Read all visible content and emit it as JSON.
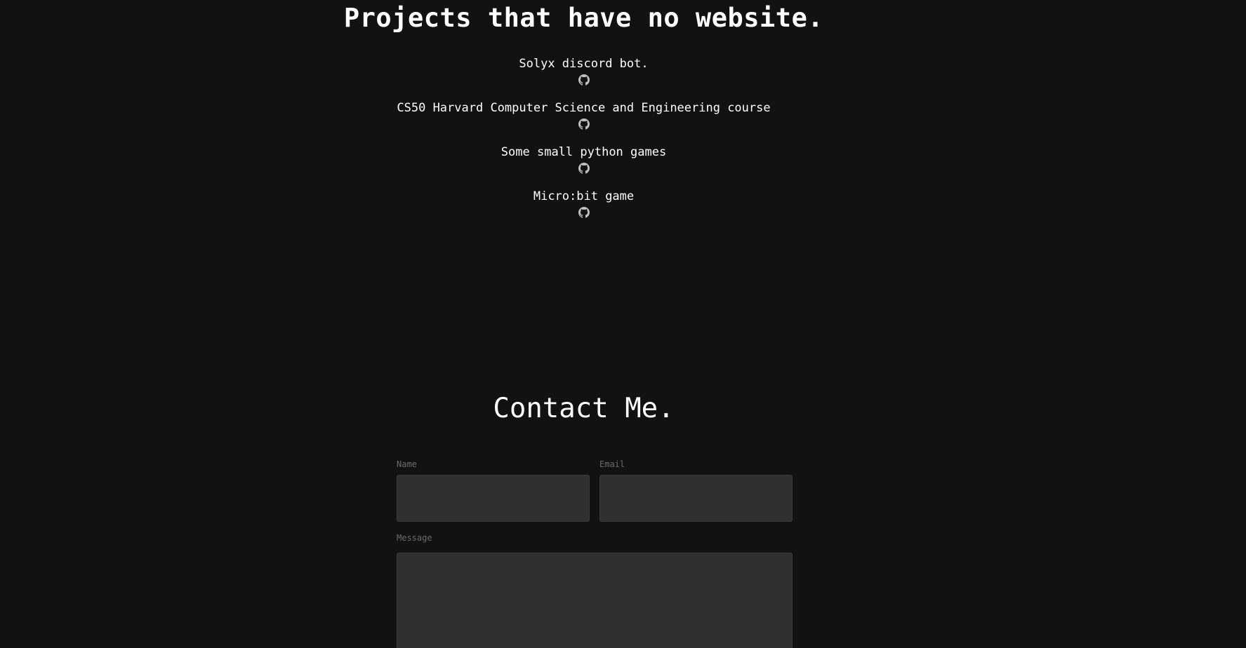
{
  "projects_section": {
    "title": "Projects that have no website.",
    "items": [
      {
        "name": "Solyx discord bot.",
        "icon": "github-icon"
      },
      {
        "name": "CS50 Harvard Computer Science and Engineering course",
        "icon": "github-icon"
      },
      {
        "name": "Some small python games",
        "icon": "github-icon"
      },
      {
        "name": "Micro:bit game",
        "icon": "github-icon"
      }
    ]
  },
  "contact_section": {
    "title": "Contact Me.",
    "name_label": "Name",
    "email_label": "Email",
    "message_label": "Message",
    "name_value": "",
    "email_value": "",
    "message_value": ""
  },
  "colors": {
    "background": "#121212",
    "text": "#ffffff",
    "label": "#6b6b6b",
    "field_background": "#303030"
  }
}
